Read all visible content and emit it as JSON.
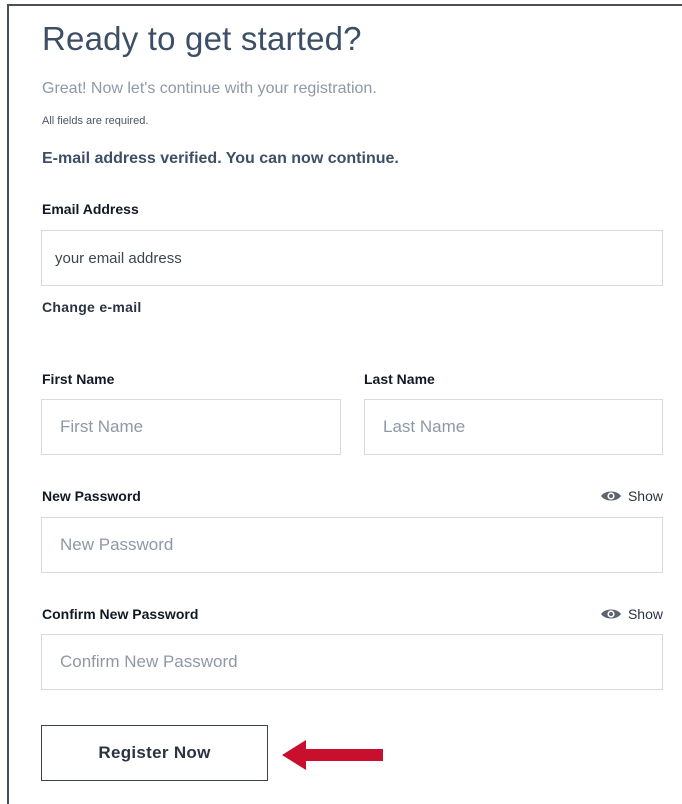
{
  "header": {
    "title": "Ready to get started?",
    "subtitle": "Great! Now let's continue with your registration.",
    "required_note": "All fields are required.",
    "verified_message": "E-mail address verified. You can now continue."
  },
  "email": {
    "label": "Email Address",
    "value": "your email address",
    "change_link": "Change e-mail"
  },
  "first_name": {
    "label": "First Name",
    "placeholder": "First Name"
  },
  "last_name": {
    "label": "Last Name",
    "placeholder": "Last Name"
  },
  "new_password": {
    "label": "New Password",
    "placeholder": "New Password",
    "show_label": "Show"
  },
  "confirm_password": {
    "label": "Confirm New Password",
    "placeholder": "Confirm New Password",
    "show_label": "Show"
  },
  "register": {
    "label": "Register Now"
  },
  "colors": {
    "annotation_arrow": "#c8102e",
    "heading": "#3d4f66"
  }
}
